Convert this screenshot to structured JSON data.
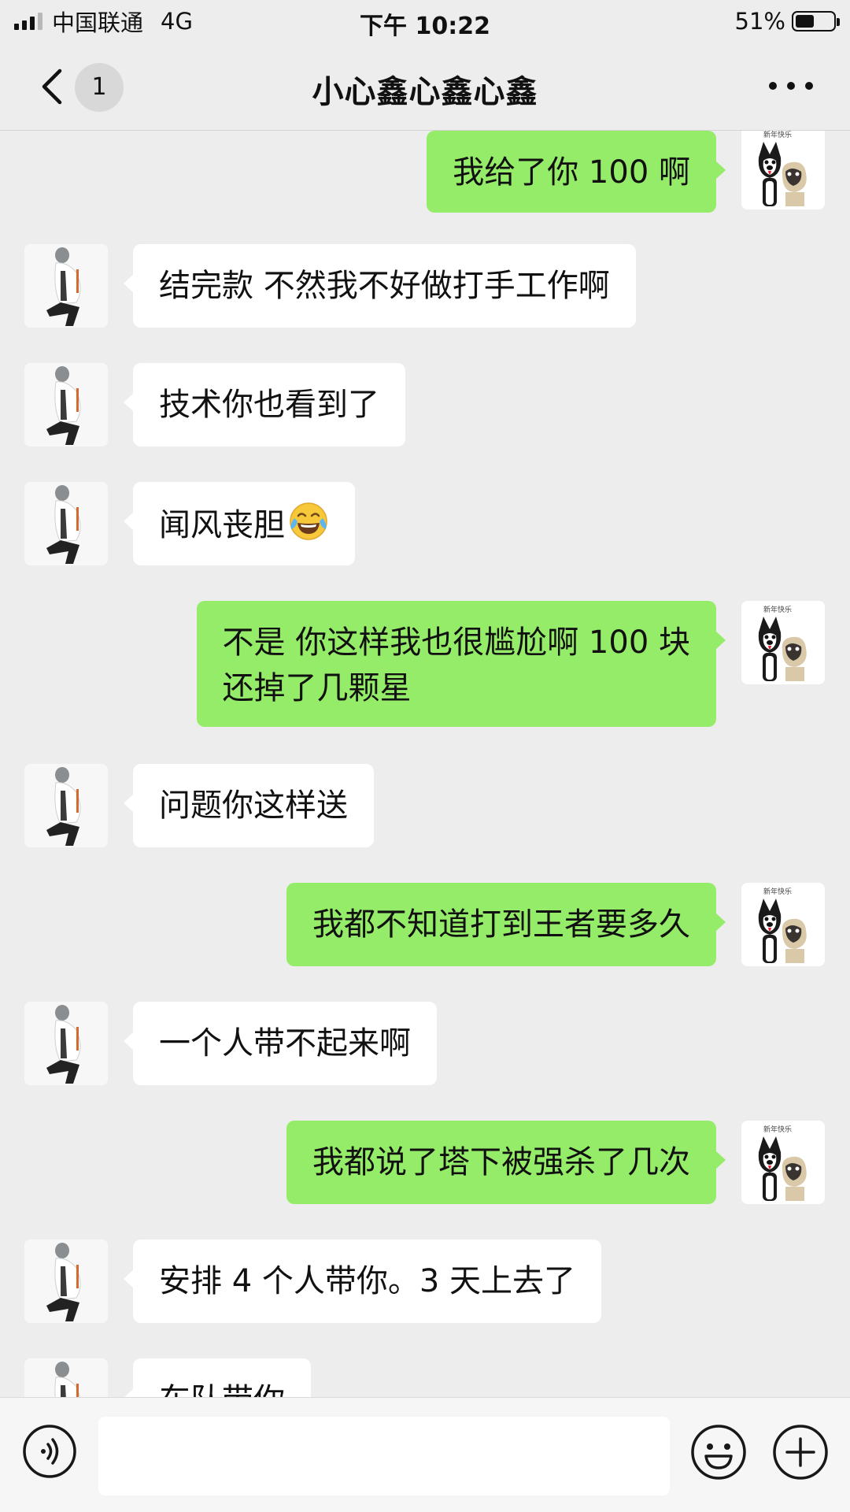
{
  "status_bar": {
    "carrier": "中国联通",
    "network": "4G",
    "time": "下午 10:22",
    "battery": "51%",
    "battery_level": 0.51
  },
  "nav": {
    "unread_count": "1",
    "title": "小心鑫心鑫心鑫"
  },
  "messages": [
    {
      "side": "out",
      "text": "我给了你 100 啊"
    },
    {
      "side": "in",
      "text": "结完款 不然我不好做打手工作啊"
    },
    {
      "side": "in",
      "text": "技术你也看到了"
    },
    {
      "side": "in",
      "text": "闻风丧胆",
      "emoji": "tears-of-joy-emoji"
    },
    {
      "side": "out",
      "text": "不是 你这样我也很尴尬啊 100 块\n还掉了几颗星"
    },
    {
      "side": "in",
      "text": "问题你这样送"
    },
    {
      "side": "out",
      "text": "我都不知道打到王者要多久"
    },
    {
      "side": "in",
      "text": "一个人带不起来啊"
    },
    {
      "side": "out",
      "text": "我都说了塔下被强杀了几次"
    },
    {
      "side": "in",
      "text": "安排 4 个人带你。3 天上去了"
    },
    {
      "side": "in",
      "text": "车队带你"
    }
  ],
  "input_bar": {
    "placeholder": ""
  },
  "colors": {
    "background": "#ededed",
    "outgoing_bubble": "#95ec69",
    "incoming_bubble": "#ffffff"
  }
}
